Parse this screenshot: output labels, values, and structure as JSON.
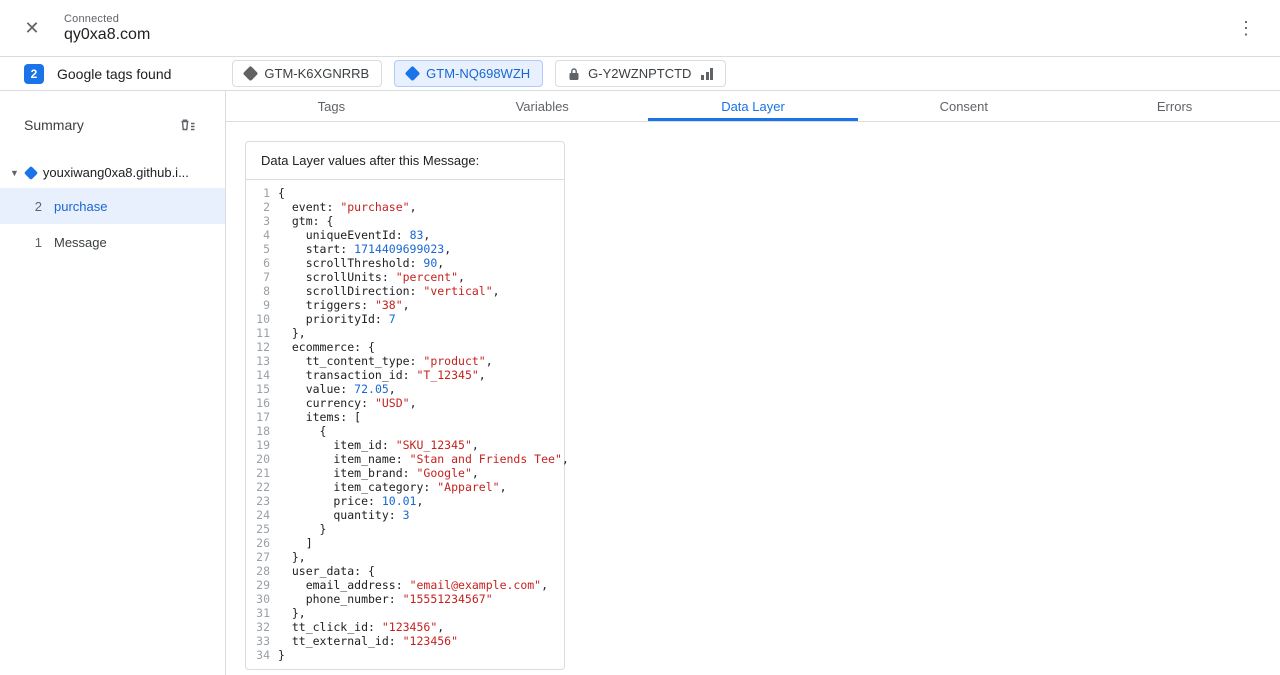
{
  "header": {
    "status": "Connected",
    "domain": "qy0xa8.com"
  },
  "tagbar": {
    "count": "2",
    "label": "Google tags found",
    "tags": [
      {
        "id": "GTM-K6XGNRRB"
      },
      {
        "id": "GTM-NQ698WZH"
      },
      {
        "id": "G-Y2WZNPTCTD"
      }
    ]
  },
  "sidebar": {
    "title": "Summary",
    "container": "youxiwang0xa8.github.i...",
    "events": [
      {
        "num": "2",
        "label": "purchase"
      },
      {
        "num": "1",
        "label": "Message"
      }
    ]
  },
  "tabs": [
    {
      "label": "Tags"
    },
    {
      "label": "Variables"
    },
    {
      "label": "Data Layer"
    },
    {
      "label": "Consent"
    },
    {
      "label": "Errors"
    }
  ],
  "colors": {
    "accent": "#1a73e8",
    "string": "#c5221f",
    "number": "#1967d2"
  },
  "panel": {
    "title": "Data Layer values after this Message:",
    "lines": [
      {
        "n": 1,
        "parts": [
          {
            "t": "p",
            "v": "{"
          }
        ]
      },
      {
        "n": 2,
        "parts": [
          {
            "t": "p",
            "v": "  event: "
          },
          {
            "t": "s",
            "v": "\"purchase\""
          },
          {
            "t": "p",
            "v": ","
          }
        ]
      },
      {
        "n": 3,
        "parts": [
          {
            "t": "p",
            "v": "  gtm: {"
          }
        ]
      },
      {
        "n": 4,
        "parts": [
          {
            "t": "p",
            "v": "    uniqueEventId: "
          },
          {
            "t": "n",
            "v": "83"
          },
          {
            "t": "p",
            "v": ","
          }
        ]
      },
      {
        "n": 5,
        "parts": [
          {
            "t": "p",
            "v": "    start: "
          },
          {
            "t": "n",
            "v": "1714409699023"
          },
          {
            "t": "p",
            "v": ","
          }
        ]
      },
      {
        "n": 6,
        "parts": [
          {
            "t": "p",
            "v": "    scrollThreshold: "
          },
          {
            "t": "n",
            "v": "90"
          },
          {
            "t": "p",
            "v": ","
          }
        ]
      },
      {
        "n": 7,
        "parts": [
          {
            "t": "p",
            "v": "    scrollUnits: "
          },
          {
            "t": "s",
            "v": "\"percent\""
          },
          {
            "t": "p",
            "v": ","
          }
        ]
      },
      {
        "n": 8,
        "parts": [
          {
            "t": "p",
            "v": "    scrollDirection: "
          },
          {
            "t": "s",
            "v": "\"vertical\""
          },
          {
            "t": "p",
            "v": ","
          }
        ]
      },
      {
        "n": 9,
        "parts": [
          {
            "t": "p",
            "v": "    triggers: "
          },
          {
            "t": "s",
            "v": "\"38\""
          },
          {
            "t": "p",
            "v": ","
          }
        ]
      },
      {
        "n": 10,
        "parts": [
          {
            "t": "p",
            "v": "    priorityId: "
          },
          {
            "t": "n",
            "v": "7"
          }
        ]
      },
      {
        "n": 11,
        "parts": [
          {
            "t": "p",
            "v": "  },"
          }
        ]
      },
      {
        "n": 12,
        "parts": [
          {
            "t": "p",
            "v": "  ecommerce: {"
          }
        ]
      },
      {
        "n": 13,
        "parts": [
          {
            "t": "p",
            "v": "    tt_content_type: "
          },
          {
            "t": "s",
            "v": "\"product\""
          },
          {
            "t": "p",
            "v": ","
          }
        ]
      },
      {
        "n": 14,
        "parts": [
          {
            "t": "p",
            "v": "    transaction_id: "
          },
          {
            "t": "s",
            "v": "\"T_12345\""
          },
          {
            "t": "p",
            "v": ","
          }
        ]
      },
      {
        "n": 15,
        "parts": [
          {
            "t": "p",
            "v": "    value: "
          },
          {
            "t": "n",
            "v": "72.05"
          },
          {
            "t": "p",
            "v": ","
          }
        ]
      },
      {
        "n": 16,
        "parts": [
          {
            "t": "p",
            "v": "    currency: "
          },
          {
            "t": "s",
            "v": "\"USD\""
          },
          {
            "t": "p",
            "v": ","
          }
        ]
      },
      {
        "n": 17,
        "parts": [
          {
            "t": "p",
            "v": "    items: ["
          }
        ]
      },
      {
        "n": 18,
        "parts": [
          {
            "t": "p",
            "v": "      {"
          }
        ]
      },
      {
        "n": 19,
        "parts": [
          {
            "t": "p",
            "v": "        item_id: "
          },
          {
            "t": "s",
            "v": "\"SKU_12345\""
          },
          {
            "t": "p",
            "v": ","
          }
        ]
      },
      {
        "n": 20,
        "parts": [
          {
            "t": "p",
            "v": "        item_name: "
          },
          {
            "t": "s",
            "v": "\"Stan and Friends Tee\""
          },
          {
            "t": "p",
            "v": ","
          }
        ]
      },
      {
        "n": 21,
        "parts": [
          {
            "t": "p",
            "v": "        item_brand: "
          },
          {
            "t": "s",
            "v": "\"Google\""
          },
          {
            "t": "p",
            "v": ","
          }
        ]
      },
      {
        "n": 22,
        "parts": [
          {
            "t": "p",
            "v": "        item_category: "
          },
          {
            "t": "s",
            "v": "\"Apparel\""
          },
          {
            "t": "p",
            "v": ","
          }
        ]
      },
      {
        "n": 23,
        "parts": [
          {
            "t": "p",
            "v": "        price: "
          },
          {
            "t": "n",
            "v": "10.01"
          },
          {
            "t": "p",
            "v": ","
          }
        ]
      },
      {
        "n": 24,
        "parts": [
          {
            "t": "p",
            "v": "        quantity: "
          },
          {
            "t": "n",
            "v": "3"
          }
        ]
      },
      {
        "n": 25,
        "parts": [
          {
            "t": "p",
            "v": "      }"
          }
        ]
      },
      {
        "n": 26,
        "parts": [
          {
            "t": "p",
            "v": "    ]"
          }
        ]
      },
      {
        "n": 27,
        "parts": [
          {
            "t": "p",
            "v": "  },"
          }
        ]
      },
      {
        "n": 28,
        "parts": [
          {
            "t": "p",
            "v": "  user_data: {"
          }
        ]
      },
      {
        "n": 29,
        "parts": [
          {
            "t": "p",
            "v": "    email_address: "
          },
          {
            "t": "s",
            "v": "\"email@example.com\""
          },
          {
            "t": "p",
            "v": ","
          }
        ]
      },
      {
        "n": 30,
        "parts": [
          {
            "t": "p",
            "v": "    phone_number: "
          },
          {
            "t": "s",
            "v": "\"15551234567\""
          }
        ]
      },
      {
        "n": 31,
        "parts": [
          {
            "t": "p",
            "v": "  },"
          }
        ]
      },
      {
        "n": 32,
        "parts": [
          {
            "t": "p",
            "v": "  tt_click_id: "
          },
          {
            "t": "s",
            "v": "\"123456\""
          },
          {
            "t": "p",
            "v": ","
          }
        ]
      },
      {
        "n": 33,
        "parts": [
          {
            "t": "p",
            "v": "  tt_external_id: "
          },
          {
            "t": "s",
            "v": "\"123456\""
          }
        ]
      },
      {
        "n": 34,
        "parts": [
          {
            "t": "p",
            "v": "}"
          }
        ]
      }
    ]
  }
}
